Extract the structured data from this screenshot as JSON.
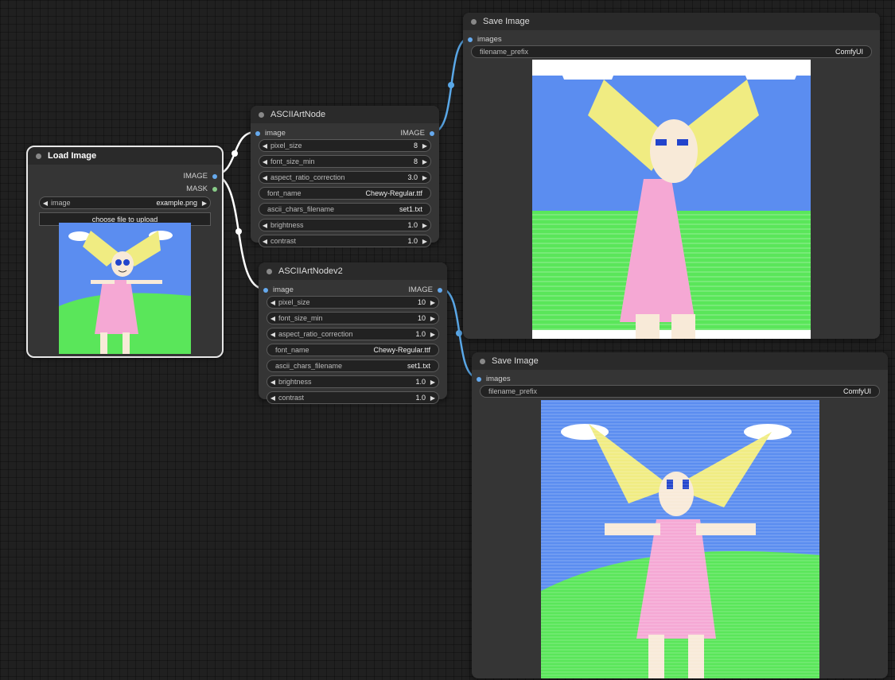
{
  "nodes": {
    "load_image": {
      "title": "Load Image",
      "outputs": [
        "IMAGE",
        "MASK"
      ],
      "image_widget": {
        "label": "image",
        "value": "example.png"
      },
      "upload_button": "choose file to upload"
    },
    "ascii_art_node": {
      "title": "ASCIIArtNode",
      "input": "image",
      "output": "IMAGE",
      "widgets": [
        {
          "label": "pixel_size",
          "value": "8"
        },
        {
          "label": "font_size_min",
          "value": "8"
        },
        {
          "label": "aspect_ratio_correction",
          "value": "3.0"
        },
        {
          "label": "font_name",
          "value": "Chewy-Regular.ttf"
        },
        {
          "label": "ascii_chars_filename",
          "value": "set1.txt"
        },
        {
          "label": "brightness",
          "value": "1.0"
        },
        {
          "label": "contrast",
          "value": "1.0"
        }
      ]
    },
    "ascii_art_node_v2": {
      "title": "ASCIIArtNodev2",
      "input": "image",
      "output": "IMAGE",
      "widgets": [
        {
          "label": "pixel_size",
          "value": "10"
        },
        {
          "label": "font_size_min",
          "value": "10"
        },
        {
          "label": "aspect_ratio_correction",
          "value": "1.0"
        },
        {
          "label": "font_name",
          "value": "Chewy-Regular.ttf"
        },
        {
          "label": "ascii_chars_filename",
          "value": "set1.txt"
        },
        {
          "label": "brightness",
          "value": "1.0"
        },
        {
          "label": "contrast",
          "value": "1.0"
        }
      ]
    },
    "save_image_1": {
      "title": "Save Image",
      "input": "images",
      "widget": {
        "label": "filename_prefix",
        "value": "ComfyUI"
      }
    },
    "save_image_2": {
      "title": "Save Image",
      "input": "images",
      "widget": {
        "label": "filename_prefix",
        "value": "ComfyUI"
      }
    }
  },
  "colors": {
    "canvas": "#202020",
    "node_body": "#353535",
    "node_header": "#2a2a2a",
    "image_slot": "#66aaee",
    "mask_slot": "#88cc88",
    "wire_image": "#5aa8e8",
    "wire_selected": "#ffffff",
    "sky": "#5b8df0",
    "grass": "#5ae65a",
    "dress": "#f5a8d4",
    "hair": "#f0ec82",
    "skin": "#f8ead8"
  }
}
